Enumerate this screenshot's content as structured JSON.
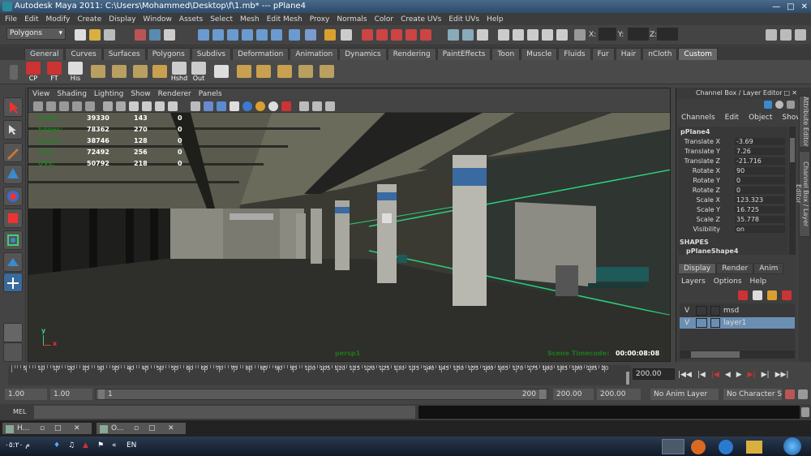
{
  "title_bar": {
    "text": "Autodesk Maya 2011: C:\\Users\\Mohammed\\Desktop\\f\\1.mb*   ---   pPlane4"
  },
  "menu": [
    "File",
    "Edit",
    "Modify",
    "Create",
    "Display",
    "Window",
    "Assets",
    "Select",
    "Mesh",
    "Edit Mesh",
    "Proxy",
    "Normals",
    "Color",
    "Create UVs",
    "Edit UVs",
    "Help"
  ],
  "status_line": {
    "mode": "Polygons",
    "x_label": "X:",
    "y_label": "Y:",
    "z_label": "Z:"
  },
  "shelf_tabs": [
    "General",
    "Curves",
    "Surfaces",
    "Polygons",
    "Subdivs",
    "Deformation",
    "Animation",
    "Dynamics",
    "Rendering",
    "PaintEffects",
    "Toon",
    "Muscle",
    "Fluids",
    "Fur",
    "Hair",
    "nCloth",
    "Custom"
  ],
  "shelf_active": "Custom",
  "shelf_buttons": [
    "CP",
    "FT",
    "His",
    "",
    "",
    "",
    "",
    "Hshd",
    "Out",
    "",
    "",
    "",
    "",
    "",
    ""
  ],
  "viewport": {
    "menu": [
      "View",
      "Shading",
      "Lighting",
      "Show",
      "Renderer",
      "Panels"
    ],
    "hud": [
      {
        "label": "Verts:",
        "a": "39330",
        "b": "143",
        "c": "0"
      },
      {
        "label": "Edges:",
        "a": "78362",
        "b": "270",
        "c": "0"
      },
      {
        "label": "Faces:",
        "a": "38746",
        "b": "128",
        "c": "0"
      },
      {
        "label": "Tris:",
        "a": "72492",
        "b": "256",
        "c": "0"
      },
      {
        "label": "UVs:",
        "a": "50792",
        "b": "218",
        "c": "0"
      }
    ],
    "camera": "persp1",
    "timecode_label": "Scene Timecode:",
    "timecode": "00:00:08:08",
    "axis_y": "y",
    "axis_x": "x"
  },
  "channel_box": {
    "header": "Channel Box / Layer Editor",
    "menu": [
      "Channels",
      "Edit",
      "Object",
      "Show"
    ],
    "object": "pPlane4",
    "attrs": [
      {
        "name": "Translate X",
        "value": "-3.69"
      },
      {
        "name": "Translate Y",
        "value": "7.26"
      },
      {
        "name": "Translate Z",
        "value": "-21.716"
      },
      {
        "name": "Rotate X",
        "value": "90"
      },
      {
        "name": "Rotate Y",
        "value": "0"
      },
      {
        "name": "Rotate Z",
        "value": "0"
      },
      {
        "name": "Scale X",
        "value": "123.323"
      },
      {
        "name": "Scale Y",
        "value": "16.725"
      },
      {
        "name": "Scale Z",
        "value": "35.778"
      },
      {
        "name": "Visibility",
        "value": "on"
      }
    ],
    "shapes_label": "SHAPES",
    "shape": "pPlaneShape4",
    "layer_tabs": [
      "Display",
      "Render",
      "Anim"
    ],
    "layer_menu": [
      "Layers",
      "Options",
      "Help"
    ],
    "layers": [
      {
        "v": "V",
        "name": "msd"
      },
      {
        "v": "V",
        "name": "layer1"
      }
    ]
  },
  "side_tabs": [
    "Attribute Editor",
    "Channel Box / Layer Editor"
  ],
  "timeline": {
    "ticks": [
      "5",
      "10",
      "15",
      "20",
      "25",
      "30",
      "35",
      "40",
      "45",
      "50",
      "55",
      "60",
      "65",
      "70",
      "75",
      "80",
      "85",
      "90",
      "95",
      "100",
      "105",
      "110",
      "115",
      "120",
      "125",
      "130",
      "135",
      "140",
      "145",
      "150",
      "155",
      "160",
      "165",
      "170",
      "175",
      "180",
      "185",
      "190",
      "195",
      "20"
    ],
    "current_frame": "200.00"
  },
  "range": {
    "start": "1.00",
    "start2": "1.00",
    "slider_start": "1",
    "slider_end": "200",
    "end": "200.00",
    "end2": "200.00",
    "anim_layer": "No Anim Layer",
    "char_set": "No Character Set"
  },
  "command_line": {
    "label": "MEL"
  },
  "task_strip": [
    {
      "label": "H..."
    },
    {
      "label": "O..."
    }
  ],
  "taskbar": {
    "clock": "م ٠٥:٢٠",
    "lang": "EN"
  }
}
